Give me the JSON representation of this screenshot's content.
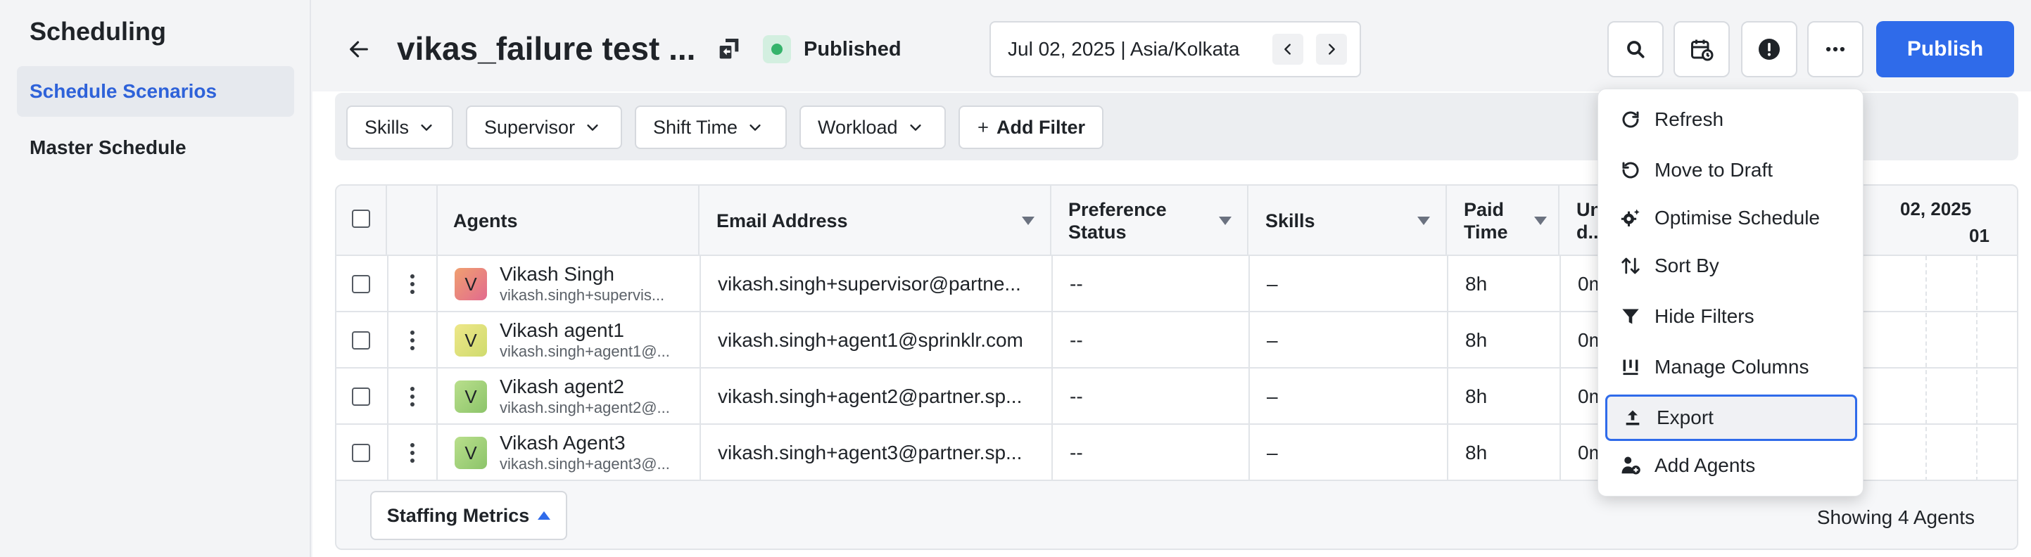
{
  "sidebar": {
    "title": "Scheduling",
    "items": [
      {
        "label": "Schedule Scenarios",
        "active": true
      },
      {
        "label": "Master Schedule",
        "active": false
      }
    ]
  },
  "header": {
    "title": "vikas_failure test ...",
    "status": "Published",
    "date": "Jul 02, 2025 | Asia/Kolkata",
    "publish_label": "Publish"
  },
  "filters": [
    "Skills",
    "Supervisor",
    "Shift Time",
    "Workload"
  ],
  "add_filter_label": "Add Filter",
  "table": {
    "columns": {
      "agents": "Agents",
      "email": "Email Address",
      "preference": "Preference\nStatus",
      "skills": "Skills",
      "paid_time": "Paid\nTime",
      "unpaid": "Un\nd.."
    },
    "timeline_date": "02, 2025",
    "timeline_hour": "01",
    "rows": [
      {
        "initial": "V",
        "name": "Vikash Singh",
        "sub": "vikash.singh+supervis...",
        "email": "vikash.singh+supervisor@partne...",
        "preference": "--",
        "skills": "–",
        "paid": "8h",
        "unpaid": "0m",
        "avatar_color": "#e98a8a"
      },
      {
        "initial": "V",
        "name": "Vikash agent1",
        "sub": "vikash.singh+agent1@...",
        "email": "vikash.singh+agent1@sprinklr.com",
        "preference": "--",
        "skills": "–",
        "paid": "8h",
        "unpaid": "0m",
        "avatar_color": "#d8df7c"
      },
      {
        "initial": "V",
        "name": "Vikash agent2",
        "sub": "vikash.singh+agent2@...",
        "email": "vikash.singh+agent2@partner.sp...",
        "preference": "--",
        "skills": "–",
        "paid": "8h",
        "unpaid": "0m",
        "avatar_color": "#9ed07a"
      },
      {
        "initial": "V",
        "name": "Vikash Agent3",
        "sub": "vikash.singh+agent3@...",
        "email": "vikash.singh+agent3@partner.sp...",
        "preference": "--",
        "skills": "–",
        "paid": "8h",
        "unpaid": "0m",
        "avatar_color": "#9ed07a"
      }
    ]
  },
  "footer": {
    "staffing_label": "Staffing Metrics",
    "showing": "Showing 4 Agents"
  },
  "menu": {
    "items": [
      {
        "label": "Refresh",
        "icon": "refresh-icon"
      },
      {
        "label": "Move to Draft",
        "icon": "undo-icon"
      },
      {
        "label": "Optimise Schedule",
        "icon": "optimise-gear-icon"
      },
      {
        "label": "Sort By",
        "icon": "sort-icon"
      },
      {
        "label": "Hide Filters",
        "icon": "filter-icon"
      },
      {
        "label": "Manage Columns",
        "icon": "columns-icon"
      },
      {
        "label": "Export",
        "icon": "export-icon",
        "selected": true
      },
      {
        "label": "Add Agents",
        "icon": "add-agent-icon"
      }
    ]
  },
  "colors": {
    "accent": "#2f6bea",
    "active_nav": "#2e62d9",
    "published_dot": "#35b36b"
  }
}
